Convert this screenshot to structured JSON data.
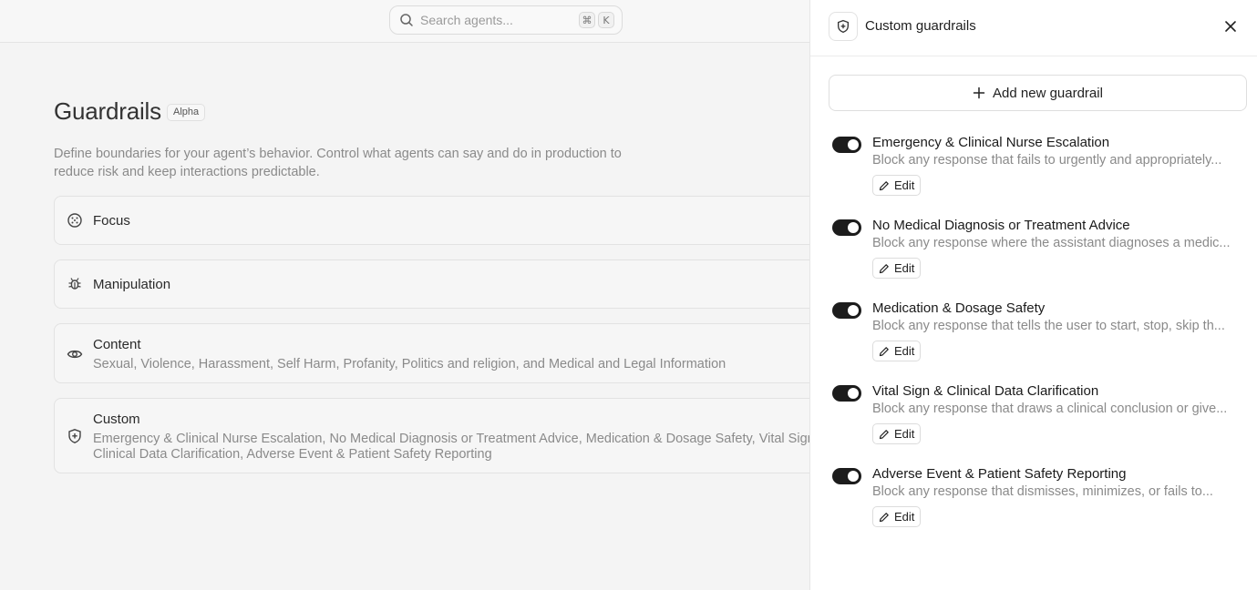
{
  "search": {
    "placeholder": "Search agents...",
    "shortcut_modifier": "⌘",
    "shortcut_key": "K"
  },
  "page": {
    "title": "Guardrails",
    "badge": "Alpha",
    "description": "Define boundaries for your agent’s behavior. Control what agents can say and do in production to reduce risk and keep interactions predictable."
  },
  "categories": [
    {
      "title": "Focus",
      "subtitle": "",
      "icon": "focus-icon"
    },
    {
      "title": "Manipulation",
      "subtitle": "",
      "icon": "bug-icon"
    },
    {
      "title": "Content",
      "subtitle": "Sexual, Violence, Harassment, Self Harm, Profanity, Politics and religion, and Medical and Legal Information",
      "icon": "eye-icon"
    },
    {
      "title": "Custom",
      "subtitle": "Emergency & Clinical Nurse Escalation, No Medical Diagnosis or Treatment Advice, Medication & Dosage Safety, Vital Sign & Clinical Data Clarification, Adverse Event & Patient Safety Reporting",
      "icon": "shield-icon"
    }
  ],
  "panel": {
    "title": "Custom guardrails",
    "add_label": "Add new guardrail",
    "edit_label": "Edit",
    "guardrails": [
      {
        "title": "Emergency & Clinical Nurse Escalation",
        "description": "Block any response that fails to urgently and appropriately...",
        "enabled": true
      },
      {
        "title": "No Medical Diagnosis or Treatment Advice",
        "description": "Block any response where the assistant diagnoses a medic...",
        "enabled": true
      },
      {
        "title": "Medication & Dosage Safety",
        "description": "Block any response that tells the user to start, stop, skip th...",
        "enabled": true
      },
      {
        "title": "Vital Sign & Clinical Data Clarification",
        "description": "Block any response that draws a clinical conclusion or give...",
        "enabled": true
      },
      {
        "title": "Adverse Event & Patient Safety Reporting",
        "description": "Block any response that dismisses, minimizes, or fails to...",
        "enabled": true
      }
    ]
  },
  "colors": {
    "toggle_on": "#1c1c1c",
    "background": "#f4f4f4",
    "panel": "#ffffff"
  }
}
